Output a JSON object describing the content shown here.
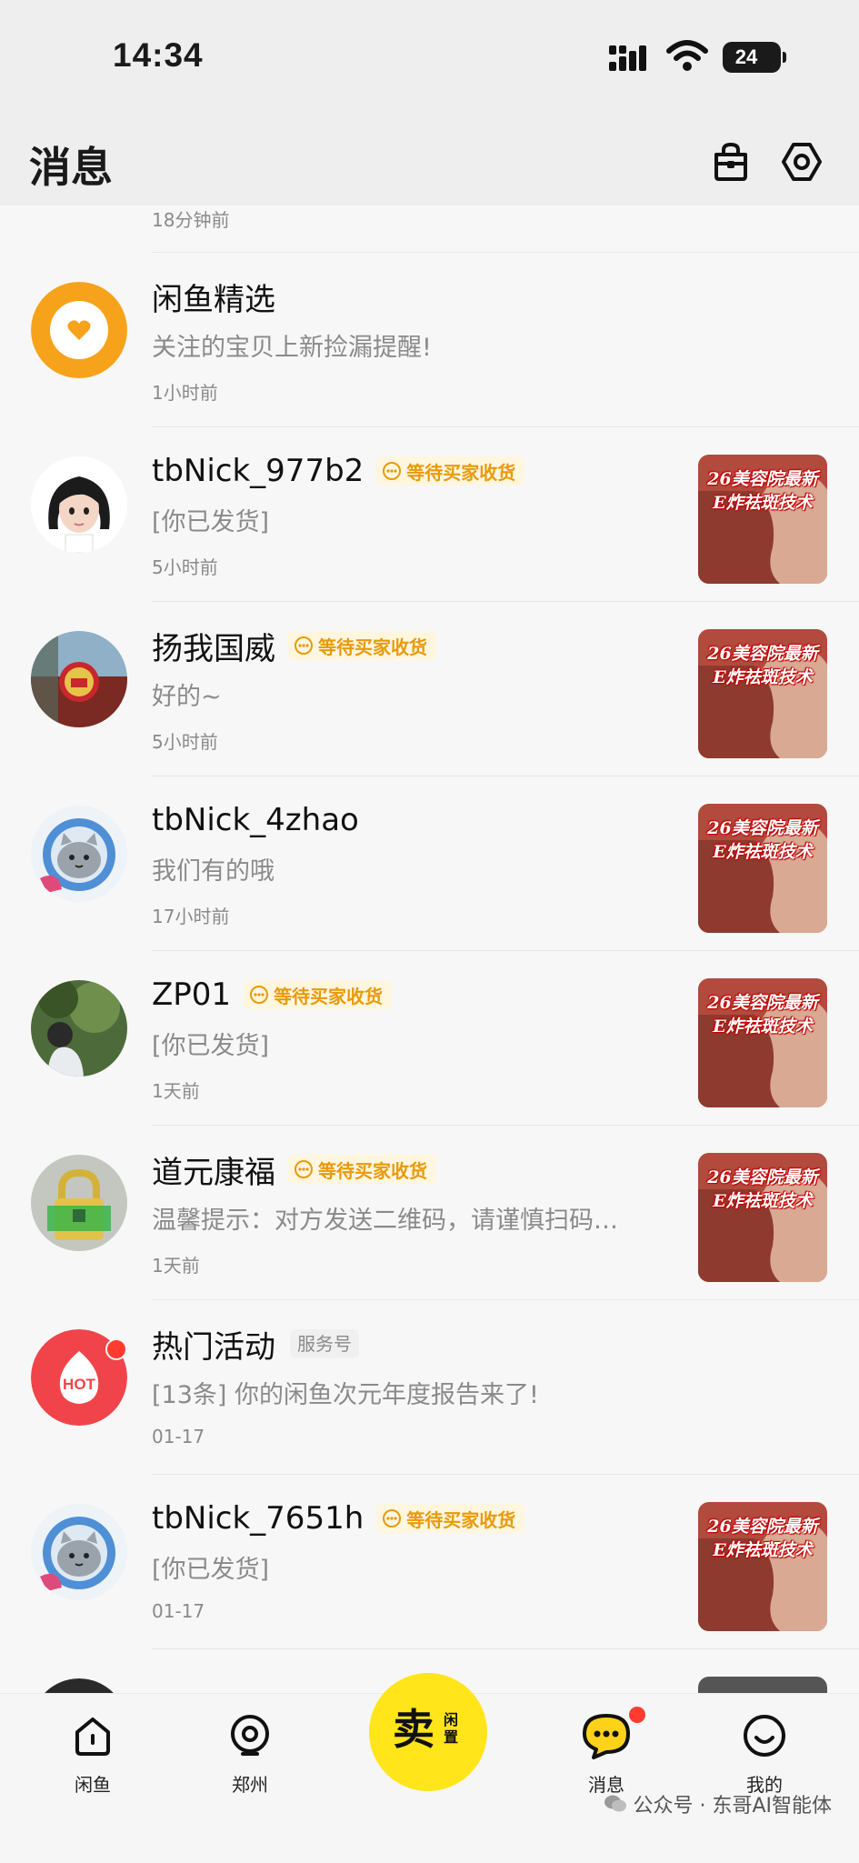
{
  "status_bar": {
    "time": "14:34",
    "battery": "24"
  },
  "header": {
    "title": "消息",
    "icons": [
      "shopping-bag-icon",
      "settings-icon"
    ]
  },
  "partial_top": {
    "time": "18分钟前"
  },
  "conversations": [
    {
      "name": "闲鱼精选",
      "preview": "关注的宝贝上新捡漏提醒!",
      "time": "1小时前",
      "badge": "",
      "tag": "",
      "avatar": "xianyu-heart-icon"
    },
    {
      "name": "tbNick_977b2",
      "preview": "[你已发货]",
      "time": "5小时前",
      "badge": "等待买家收货",
      "tag": "",
      "avatar": "girl-avatar"
    },
    {
      "name": "扬我国威",
      "preview": "好的~",
      "time": "5小时前",
      "badge": "等待买家收货",
      "tag": "",
      "avatar": "emblem-avatar"
    },
    {
      "name": "tbNick_4zhao",
      "preview": "我们有的哦",
      "time": "17小时前",
      "badge": "",
      "tag": "",
      "avatar": "cat-astronaut-avatar"
    },
    {
      "name": "ZP01",
      "preview": "[你已发货]",
      "time": "1天前",
      "badge": "等待买家收货",
      "tag": "",
      "avatar": "photo-avatar"
    },
    {
      "name": "道元康福",
      "preview": "温馨提示：对方发送二维码，请谨慎扫码…",
      "time": "1天前",
      "badge": "等待买家收货",
      "tag": "",
      "avatar": "lock-avatar"
    },
    {
      "name": "热门活动",
      "preview": "[13条] 你的闲鱼次元年度报告来了!",
      "time": "01-17",
      "badge": "",
      "tag": "服务号",
      "avatar": "hot-icon"
    },
    {
      "name": "tbNick_7651h",
      "preview": "[你已发货]",
      "time": "01-17",
      "badge": "等待买家收货",
      "tag": "",
      "avatar": "cat-astronaut-avatar"
    }
  ],
  "thumbnail": {
    "line1": "26美容院最新",
    "line2": "E炸祛斑技术"
  },
  "bottom_nav": {
    "items": [
      {
        "label": "闲鱼",
        "icon": "home-icon"
      },
      {
        "label": "郑州",
        "icon": "location-icon"
      },
      {
        "label": "消息",
        "icon": "chat-icon"
      },
      {
        "label": "我的",
        "icon": "profile-icon"
      }
    ],
    "sell": {
      "main": "卖",
      "sub": "闲置"
    }
  },
  "watermark": "公众号 · 东哥AI智能体",
  "colors": {
    "accent": "#ffe51a",
    "badge_text": "#e89a0a",
    "badge_bg": "#fff6e0",
    "unread": "#ff3b30"
  }
}
